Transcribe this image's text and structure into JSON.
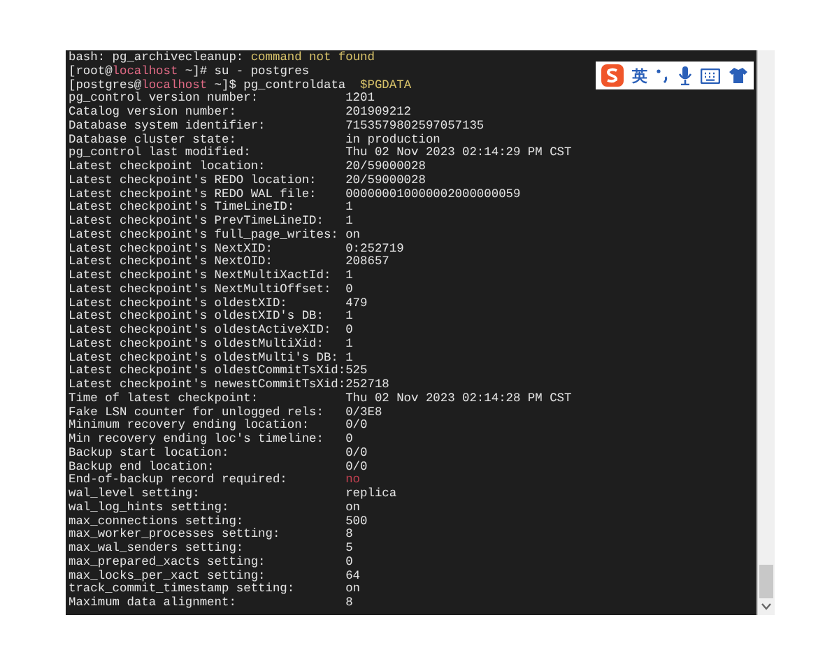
{
  "terminal": {
    "lines": [
      {
        "kind": "error",
        "text": "bash: pg_archivecleanup: ",
        "message": "command not found"
      },
      {
        "kind": "prompt",
        "user": "[root@",
        "host": "localhost",
        "path": " ~]#",
        "command": "su - postgres"
      },
      {
        "kind": "prompt",
        "user": "[postgres@",
        "host": "localhost",
        "path": " ~]$",
        "command": "pg_controldata",
        "argument": "$PGDATA"
      },
      {
        "kind": "field",
        "label": "pg_control version number:",
        "value": "1201",
        "alert": false
      },
      {
        "kind": "field",
        "label": "Catalog version number:",
        "value": "201909212",
        "alert": false
      },
      {
        "kind": "field",
        "label": "Database system identifier:",
        "value": "7153579802597057135",
        "alert": false
      },
      {
        "kind": "field",
        "label": "Database cluster state:",
        "value": "in production",
        "alert": false
      },
      {
        "kind": "field",
        "label": "pg_control last modified:",
        "value": "Thu 02 Nov 2023 02:14:29 PM CST",
        "alert": false
      },
      {
        "kind": "field",
        "label": "Latest checkpoint location:",
        "value": "20/59000028",
        "alert": false
      },
      {
        "kind": "field",
        "label": "Latest checkpoint's REDO location:",
        "value": "20/59000028",
        "alert": false
      },
      {
        "kind": "field",
        "label": "Latest checkpoint's REDO WAL file:",
        "value": "000000010000002000000059",
        "alert": false
      },
      {
        "kind": "field",
        "label": "Latest checkpoint's TimeLineID:",
        "value": "1",
        "alert": false
      },
      {
        "kind": "field",
        "label": "Latest checkpoint's PrevTimeLineID:",
        "value": "1",
        "alert": false
      },
      {
        "kind": "field",
        "label": "Latest checkpoint's full_page_writes:",
        "value": "on",
        "alert": false
      },
      {
        "kind": "field",
        "label": "Latest checkpoint's NextXID:",
        "value": "0:252719",
        "alert": false
      },
      {
        "kind": "field",
        "label": "Latest checkpoint's NextOID:",
        "value": "208657",
        "alert": false
      },
      {
        "kind": "field",
        "label": "Latest checkpoint's NextMultiXactId:",
        "value": "1",
        "alert": false
      },
      {
        "kind": "field",
        "label": "Latest checkpoint's NextMultiOffset:",
        "value": "0",
        "alert": false
      },
      {
        "kind": "field",
        "label": "Latest checkpoint's oldestXID:",
        "value": "479",
        "alert": false
      },
      {
        "kind": "field",
        "label": "Latest checkpoint's oldestXID's DB:",
        "value": "1",
        "alert": false
      },
      {
        "kind": "field",
        "label": "Latest checkpoint's oldestActiveXID:",
        "value": "0",
        "alert": false
      },
      {
        "kind": "field",
        "label": "Latest checkpoint's oldestMultiXid:",
        "value": "1",
        "alert": false
      },
      {
        "kind": "field",
        "label": "Latest checkpoint's oldestMulti's DB:",
        "value": "1",
        "alert": false
      },
      {
        "kind": "field",
        "label": "Latest checkpoint's oldestCommitTsXid:",
        "value": "525",
        "alert": false
      },
      {
        "kind": "field",
        "label": "Latest checkpoint's newestCommitTsXid:",
        "value": "252718",
        "alert": false
      },
      {
        "kind": "field",
        "label": "Time of latest checkpoint:",
        "value": "Thu 02 Nov 2023 02:14:28 PM CST",
        "alert": false
      },
      {
        "kind": "field",
        "label": "Fake LSN counter for unlogged rels:",
        "value": "0/3E8",
        "alert": false
      },
      {
        "kind": "field",
        "label": "Minimum recovery ending location:",
        "value": "0/0",
        "alert": false
      },
      {
        "kind": "field",
        "label": "Min recovery ending loc's timeline:",
        "value": "0",
        "alert": false
      },
      {
        "kind": "field",
        "label": "Backup start location:",
        "value": "0/0",
        "alert": false
      },
      {
        "kind": "field",
        "label": "Backup end location:",
        "value": "0/0",
        "alert": false
      },
      {
        "kind": "field",
        "label": "End-of-backup record required:",
        "value": "no",
        "alert": true
      },
      {
        "kind": "field",
        "label": "wal_level setting:",
        "value": "replica",
        "alert": false
      },
      {
        "kind": "field",
        "label": "wal_log_hints setting:",
        "value": "on",
        "alert": false
      },
      {
        "kind": "field",
        "label": "max_connections setting:",
        "value": "500",
        "alert": false
      },
      {
        "kind": "field",
        "label": "max_worker_processes setting:",
        "value": "8",
        "alert": false
      },
      {
        "kind": "field",
        "label": "max_wal_senders setting:",
        "value": "5",
        "alert": false
      },
      {
        "kind": "field",
        "label": "max_prepared_xacts setting:",
        "value": "0",
        "alert": false
      },
      {
        "kind": "field",
        "label": "max_locks_per_xact setting:",
        "value": "64",
        "alert": false
      },
      {
        "kind": "field",
        "label": "track_commit_timestamp setting:",
        "value": "on",
        "alert": false
      },
      {
        "kind": "field",
        "label": "Maximum data alignment:",
        "value": "8",
        "alert": false
      }
    ]
  },
  "ime_toolbar": {
    "mode": "英"
  }
}
